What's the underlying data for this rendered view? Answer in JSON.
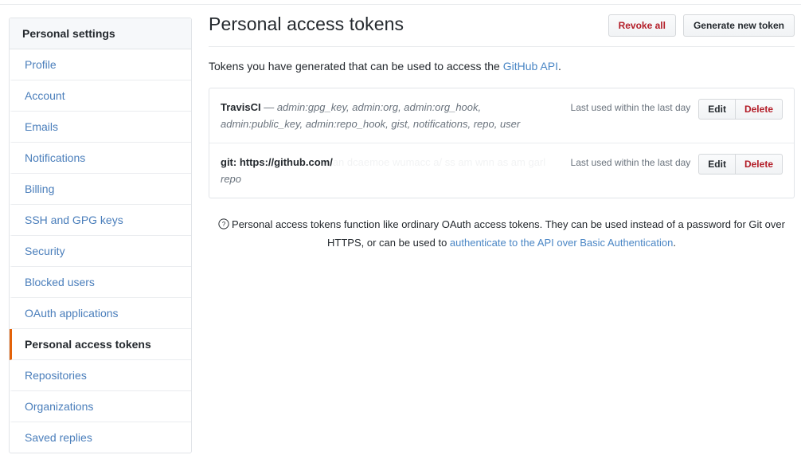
{
  "sidebar": {
    "header": "Personal settings",
    "items": [
      {
        "label": "Profile",
        "selected": false
      },
      {
        "label": "Account",
        "selected": false
      },
      {
        "label": "Emails",
        "selected": false
      },
      {
        "label": "Notifications",
        "selected": false
      },
      {
        "label": "Billing",
        "selected": false
      },
      {
        "label": "SSH and GPG keys",
        "selected": false
      },
      {
        "label": "Security",
        "selected": false
      },
      {
        "label": "Blocked users",
        "selected": false
      },
      {
        "label": "OAuth applications",
        "selected": false
      },
      {
        "label": "Personal access tokens",
        "selected": true
      },
      {
        "label": "Repositories",
        "selected": false
      },
      {
        "label": "Organizations",
        "selected": false
      },
      {
        "label": "Saved replies",
        "selected": false
      }
    ]
  },
  "header": {
    "title": "Personal access tokens",
    "revoke_all_label": "Revoke all",
    "generate_label": "Generate new token"
  },
  "intro": {
    "before_link": "Tokens you have generated that can be used to access the ",
    "link_text": "GitHub API",
    "after_link": "."
  },
  "tokens": [
    {
      "name": "TravisCI",
      "separator": " — ",
      "scopes": "admin:gpg_key, admin:org, admin:org_hook, admin:public_key, admin:repo_hook, gist, notifications, repo, user",
      "redacted": "",
      "last_used": "Last used within the last day",
      "edit_label": "Edit",
      "delete_label": "Delete"
    },
    {
      "name": "git: https://github.com/",
      "separator": "",
      "scopes": "repo",
      "redacted": "an dcaemoe wumacc a/ ss am  wnn as am    garl",
      "last_used": "Last used within the last day",
      "edit_label": "Edit",
      "delete_label": "Delete"
    }
  ],
  "note": {
    "icon": "question-circle-icon",
    "line1": "Personal access tokens function like ordinary OAuth access tokens. They can be used instead of a password for Git",
    "line2_before": "over HTTPS, or can be used to ",
    "line2_link": "authenticate to the API over Basic Authentication",
    "line2_after": "."
  },
  "colors": {
    "link": "#4a86c5",
    "danger": "#b31d28",
    "accent": "#e36209",
    "border": "#e1e4e8",
    "header_bg": "#f6f8fa",
    "text": "#24292e",
    "muted": "#6a737d"
  }
}
